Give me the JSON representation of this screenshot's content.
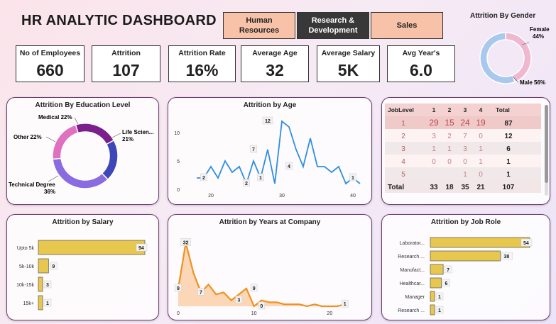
{
  "header": {
    "title": "HR ANALYTIC DASHBOARD",
    "tabs": [
      {
        "label": "Human\nResources",
        "active": false
      },
      {
        "label": "Research &\nDevelopment",
        "active": true
      },
      {
        "label": "Sales",
        "active": false
      }
    ]
  },
  "kpis": [
    {
      "label": "No of Employees",
      "value": "660"
    },
    {
      "label": "Attrition",
      "value": "107"
    },
    {
      "label": "Attrition Rate",
      "value": "16%"
    },
    {
      "label": "Average Age",
      "value": "32"
    },
    {
      "label": "Average Salary",
      "value": "5K"
    },
    {
      "label": "Avg Year's",
      "value": "6.0"
    }
  ],
  "colors": {
    "accent_tab": "#f7c2a8",
    "active_tab": "#383838",
    "age_line": "#2f8fe0",
    "years_line": "#f0921e",
    "bar_fill": "#e8c74e",
    "female": "#f0b8d0",
    "male": "#a9c8ee",
    "edu": [
      "#7b1f8c",
      "#3f47b8",
      "#8a6be0",
      "#e070c0"
    ],
    "heat_high": "#f0c9c9"
  },
  "chart_data": [
    {
      "id": "gender",
      "type": "pie",
      "title": "Attrition By Gender",
      "slices": [
        {
          "name": "Female",
          "label": "Female\n44%",
          "value": 44
        },
        {
          "name": "Male",
          "label": "Male 56%",
          "value": 56
        }
      ]
    },
    {
      "id": "education",
      "type": "pie",
      "title": "Attrition By Education Level",
      "slices": [
        {
          "name": "Medical",
          "label": "Medical 22%",
          "value": 22
        },
        {
          "name": "Life Sciences",
          "label": "Life Scien...\n21%",
          "value": 21
        },
        {
          "name": "Technical Degree",
          "label": "Technical Degree\n36%",
          "value": 36
        },
        {
          "name": "Other",
          "label": "Other 22%",
          "value": 22
        }
      ]
    },
    {
      "id": "age",
      "type": "line",
      "title": "Attrition by Age",
      "x": [
        18,
        19,
        20,
        21,
        22,
        23,
        24,
        25,
        26,
        27,
        28,
        29,
        30,
        31,
        32,
        33,
        34,
        35,
        36,
        37,
        38,
        39,
        40,
        41
      ],
      "y": [
        2,
        2,
        4,
        2,
        5,
        3,
        4,
        1,
        5,
        2,
        7,
        1,
        12,
        11,
        7,
        4,
        9,
        4,
        4,
        3,
        4,
        1,
        2,
        1
      ],
      "point_labels": [
        {
          "x": 19,
          "y": 2,
          "text": "2"
        },
        {
          "x": 25,
          "y": 1,
          "text": "2"
        },
        {
          "x": 26,
          "y": 7,
          "text": "7"
        },
        {
          "x": 27,
          "y": 2,
          "text": "1"
        },
        {
          "x": 28,
          "y": 12,
          "text": "12"
        },
        {
          "x": 31,
          "y": 4,
          "text": "4"
        },
        {
          "x": 40,
          "y": 2,
          "text": "1"
        }
      ],
      "xticks": [
        20,
        30,
        40
      ],
      "yticks": [
        0,
        5,
        10
      ],
      "xlim": [
        17,
        42
      ],
      "ylim": [
        0,
        13
      ]
    },
    {
      "id": "joblevel",
      "type": "table",
      "columns": [
        "JobLevel",
        "1",
        "2",
        "3",
        "4",
        "Total"
      ],
      "rows": [
        {
          "level": "1",
          "cells": [
            "29",
            "15",
            "24",
            "19"
          ],
          "total": "87"
        },
        {
          "level": "2",
          "cells": [
            "3",
            "2",
            "7",
            "0"
          ],
          "total": "12"
        },
        {
          "level": "3",
          "cells": [
            "1",
            "1",
            "3",
            "1"
          ],
          "total": "6"
        },
        {
          "level": "4",
          "cells": [
            "0",
            "0",
            "0",
            "1"
          ],
          "total": "1"
        },
        {
          "level": "5",
          "cells": [
            "",
            "",
            "1",
            "0"
          ],
          "total": "1"
        }
      ],
      "totals": {
        "label": "Total",
        "cells": [
          "33",
          "18",
          "35",
          "21"
        ],
        "total": "107"
      }
    },
    {
      "id": "salary",
      "type": "bar",
      "title": "Attrition by Salary",
      "categories": [
        "Upto 5k",
        "5k-10k",
        "10k-15k",
        "15k+"
      ],
      "values": [
        94,
        9,
        3,
        1
      ]
    },
    {
      "id": "years",
      "type": "area",
      "title": "Attrition by Years at Company",
      "x": [
        0,
        1,
        2,
        3,
        4,
        5,
        6,
        7,
        8,
        9,
        10,
        11,
        12,
        13,
        14,
        15,
        16,
        17,
        18,
        19,
        20,
        21,
        22
      ],
      "y": [
        9,
        32,
        17,
        7,
        11,
        6,
        7,
        3,
        6,
        9,
        0,
        3,
        2,
        2,
        1,
        1,
        1,
        0,
        1,
        0,
        0,
        0,
        1
      ],
      "point_labels": [
        {
          "x": 0,
          "y": 9,
          "text": "9"
        },
        {
          "x": 1,
          "y": 32,
          "text": "32"
        },
        {
          "x": 3,
          "y": 7,
          "text": "7"
        },
        {
          "x": 8,
          "y": 3,
          "text": "3"
        },
        {
          "x": 10,
          "y": 9,
          "text": "9"
        },
        {
          "x": 11,
          "y": 0,
          "text": "0"
        },
        {
          "x": 22,
          "y": 1,
          "text": "1"
        }
      ],
      "xticks": [
        0,
        10,
        20
      ],
      "xlim": [
        0,
        22.5
      ],
      "ylim": [
        0,
        34
      ]
    },
    {
      "id": "jobrole",
      "type": "bar",
      "title": "Attrition by Job Role",
      "categories": [
        "Laborator...",
        "Research ...",
        "Manufact...",
        "Healthcar...",
        "Manager",
        "Research ..."
      ],
      "values": [
        54,
        38,
        7,
        6,
        1,
        1
      ]
    }
  ]
}
